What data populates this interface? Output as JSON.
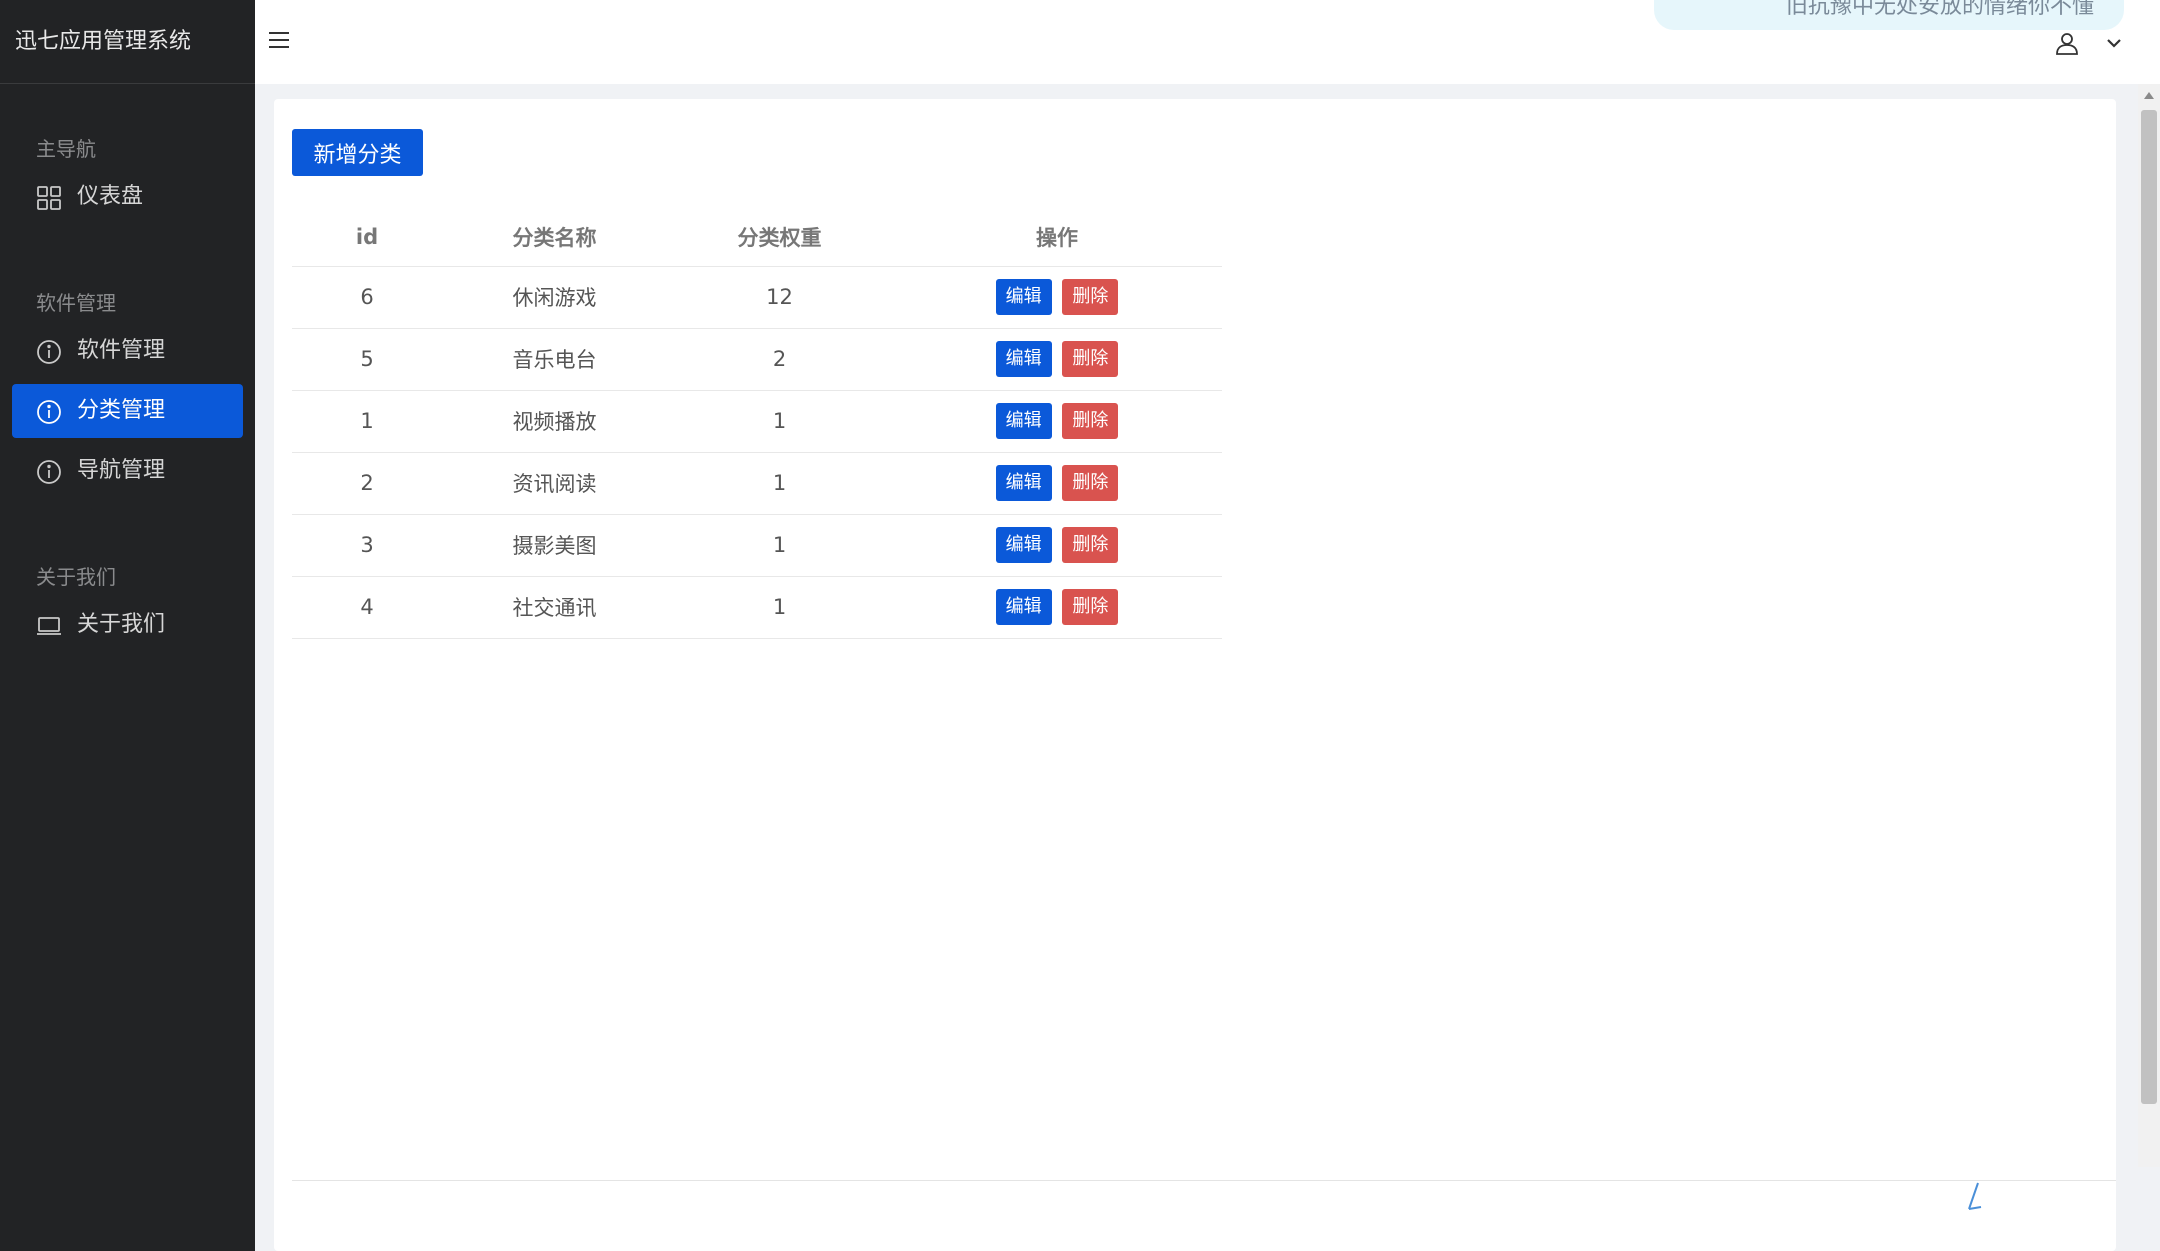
{
  "app": {
    "title": "迅七应用管理系统"
  },
  "sidebar": {
    "sections": [
      {
        "title": "主导航",
        "items": [
          {
            "label": "仪表盘",
            "icon": "grid-icon"
          }
        ]
      },
      {
        "title": "软件管理",
        "items": [
          {
            "label": "软件管理",
            "icon": "info-circle-icon"
          },
          {
            "label": "分类管理",
            "icon": "info-circle-icon",
            "active": true
          },
          {
            "label": "导航管理",
            "icon": "info-circle-icon"
          }
        ]
      },
      {
        "title": "关于我们",
        "items": [
          {
            "label": "关于我们",
            "icon": "laptop-icon"
          }
        ]
      }
    ]
  },
  "header": {
    "toast_text": "旧抗豫中无处安放的情绪你不懂"
  },
  "main": {
    "add_button_label": "新增分类",
    "table": {
      "headers": [
        "id",
        "分类名称",
        "分类权重",
        "操作"
      ],
      "rows": [
        {
          "id": "6",
          "name": "休闲游戏",
          "weight": "12"
        },
        {
          "id": "5",
          "name": "音乐电台",
          "weight": "2"
        },
        {
          "id": "1",
          "name": "视频播放",
          "weight": "1"
        },
        {
          "id": "2",
          "name": "资讯阅读",
          "weight": "1"
        },
        {
          "id": "3",
          "name": "摄影美图",
          "weight": "1"
        },
        {
          "id": "4",
          "name": "社交通讯",
          "weight": "1"
        }
      ],
      "edit_label": "编辑",
      "delete_label": "删除"
    }
  },
  "colors": {
    "primary": "#0b59d9",
    "danger": "#d9534f",
    "sidebar_bg": "#222325"
  }
}
